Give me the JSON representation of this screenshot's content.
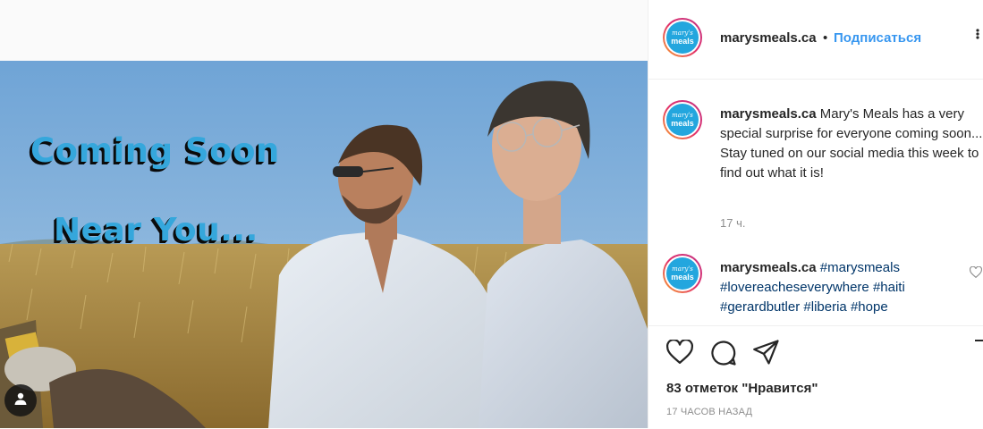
{
  "post": {
    "overlay_line1": "Coming Soon",
    "overlay_line2": "Near You..."
  },
  "header": {
    "username": "marysmeals.ca",
    "separator": "•",
    "follow_label": "Подписаться",
    "more_label": "..."
  },
  "avatar": {
    "line1": "mary's",
    "line2": "meals"
  },
  "caption": {
    "username": "marysmeals.ca",
    "text": "Mary's Meals has a very special surprise for everyone coming soon... Stay tuned on our social media this week to find out what it is!",
    "time": "17 ч."
  },
  "comment": {
    "username": "marysmeals.ca",
    "tags": [
      "#marysmeals",
      "#lovereacheseverywhere",
      "#haiti",
      "#gerardbutler",
      "#liberia",
      "#hope"
    ]
  },
  "footer": {
    "likes": "83 отметок \"Нравится\"",
    "post_time": "17 часов назад"
  },
  "icons": {
    "like": "heart-icon",
    "comment": "comment-icon",
    "share": "send-icon",
    "save": "bookmark-icon",
    "user_tags": "user-icon",
    "more": "more-options-icon"
  },
  "colors": {
    "link_blue": "#3897f0",
    "hashtag": "#003569",
    "logo_blue": "#23a6de",
    "overlay_text": "#35a7dc"
  }
}
